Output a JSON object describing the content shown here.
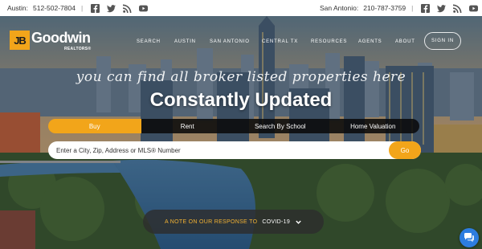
{
  "topbar": {
    "left": {
      "city": "Austin:",
      "phone": "512-502-7804"
    },
    "right": {
      "city": "San Antonio:",
      "phone": "210-787-3759"
    },
    "social": [
      "facebook-icon",
      "twitter-icon",
      "rss-icon",
      "youtube-icon"
    ]
  },
  "logo": {
    "badge": "JB",
    "name": "Goodwin",
    "sub": "REALTORS®"
  },
  "nav": {
    "items": [
      "SEARCH",
      "AUSTIN",
      "SAN ANTONIO",
      "CENTRAL TX",
      "RESOURCES",
      "AGENTS",
      "ABOUT"
    ],
    "signin": "SIGN IN"
  },
  "hero": {
    "tagline": "you can find all broker listed properties here",
    "headline": "Constantly Updated"
  },
  "search": {
    "tabs": [
      "Buy",
      "Rent",
      "Search By School",
      "Home Valuation"
    ],
    "active_tab": "Buy",
    "placeholder": "Enter a City, Zip, Address or MLS® Number",
    "go_label": "Go"
  },
  "note": {
    "prefix": "A NOTE ON OUR RESPONSE TO",
    "topic": "COVID-19"
  },
  "colors": {
    "accent": "#f2a51a",
    "tab_bg": "#0a0a0a",
    "chat": "#2d7de0"
  }
}
